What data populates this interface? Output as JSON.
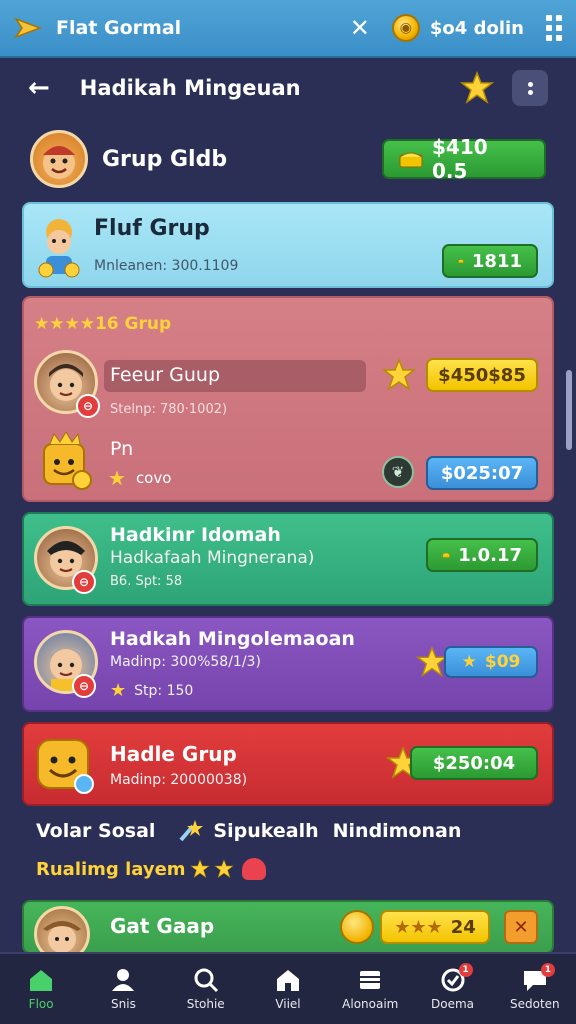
{
  "topbar": {
    "title": "Flat Gormal",
    "balance": "$o4 dolin"
  },
  "header": {
    "title": "Hadikah Mingeuan"
  },
  "group": {
    "title": "Grup Gldb",
    "price": "$410 0.5"
  },
  "cards": [
    {
      "title": "Fluf Grup",
      "sub": "Mnleanen: 300.1109",
      "price": "1811"
    },
    {
      "stars_title": "16 Grup",
      "row1_name": "Feeur Guup",
      "row1_sub": "Stelnp: 780·1002)",
      "row1_price": "$450$85",
      "row2_name": "Pn",
      "row2_sub": "covo",
      "row2_price": "$025:07"
    },
    {
      "title": "Hadkinr Idomah",
      "sub": "Hadkafaah Mingnerana)",
      "sub2": "B6. Spt: 58",
      "price": "1.0.17"
    },
    {
      "title": "Hadkah Mingolemaoan",
      "sub": "Madinp: 300%58/1/3)",
      "sub2": "Stp: 150",
      "price": "$09"
    },
    {
      "title": "Hadle Grup",
      "sub": "Madinp: 20000038)",
      "price": "$250:04"
    }
  ],
  "social": {
    "left": "Volar Sosal",
    "middle": "Sipukealh",
    "right": "Nindimonan"
  },
  "trending": {
    "label": "Rualimg layem"
  },
  "last_card": {
    "title": "Gat Gaap",
    "price": "24"
  },
  "nav": [
    {
      "label": "Floo",
      "icon": "home-icon",
      "badge": ""
    },
    {
      "label": "Snis",
      "icon": "user-icon",
      "badge": ""
    },
    {
      "label": "Stohie",
      "icon": "search-icon",
      "badge": ""
    },
    {
      "label": "Viiel",
      "icon": "house-icon",
      "badge": ""
    },
    {
      "label": "Alonoaim",
      "icon": "store-icon",
      "badge": ""
    },
    {
      "label": "Doema",
      "icon": "check-icon",
      "badge": "1"
    },
    {
      "label": "Sedoten",
      "icon": "chat-icon",
      "badge": "1"
    }
  ],
  "colors": {
    "accent": "#48d06a",
    "topbar": "#4fa4d6",
    "background": "#2b2f55"
  }
}
